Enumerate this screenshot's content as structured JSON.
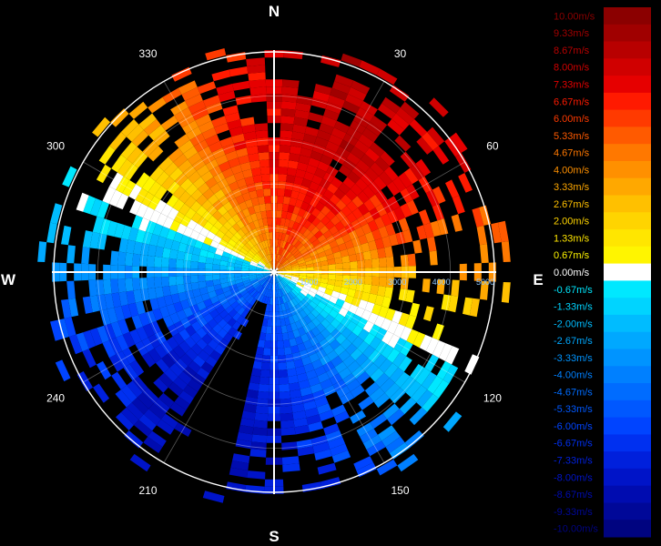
{
  "chart_data": {
    "type": "heatmap",
    "subtype": "polar-ppi",
    "title": "",
    "compass": {
      "north": "N",
      "east": "E",
      "south": "S",
      "west": "W"
    },
    "angle_ticks": [
      {
        "deg": 30,
        "label": "30"
      },
      {
        "deg": 60,
        "label": "60"
      },
      {
        "deg": 120,
        "label": "120"
      },
      {
        "deg": 150,
        "label": "150"
      },
      {
        "deg": 210,
        "label": "210"
      },
      {
        "deg": 240,
        "label": "240"
      },
      {
        "deg": 300,
        "label": "300"
      },
      {
        "deg": 330,
        "label": "330"
      }
    ],
    "range_ticks": [
      {
        "value": 1000,
        "label": "1000"
      },
      {
        "value": 2000,
        "label": "2000"
      },
      {
        "value": 3000,
        "label": "3000"
      },
      {
        "value": 4000,
        "label": "4000"
      },
      {
        "value": 5000,
        "label": "5000"
      }
    ],
    "range_max": 5000,
    "radial_velocity_field": {
      "unit": "m/s",
      "zero_line_azimuth_deg": 115,
      "max_outbound_azimuth_deg": 205,
      "max_inbound_azimuth_deg": 25,
      "peak_speed": 8.5,
      "inner_speed": 5.0,
      "data_gap_azimuths_deg": [
        195,
        200,
        205,
        210
      ]
    },
    "colorbar": {
      "levels": [
        {
          "label": "10.00m/s",
          "value": 10.0,
          "color": "#8b0000"
        },
        {
          "label": "9.33m/s",
          "value": 9.33,
          "color": "#a00000"
        },
        {
          "label": "8.67m/s",
          "value": 8.67,
          "color": "#b80000"
        },
        {
          "label": "8.00m/s",
          "value": 8.0,
          "color": "#d00000"
        },
        {
          "label": "7.33m/s",
          "value": 7.33,
          "color": "#e60000"
        },
        {
          "label": "6.67m/s",
          "value": 6.67,
          "color": "#ff1a00"
        },
        {
          "label": "6.00m/s",
          "value": 6.0,
          "color": "#ff3a00"
        },
        {
          "label": "5.33m/s",
          "value": 5.33,
          "color": "#ff5a00"
        },
        {
          "label": "4.67m/s",
          "value": 4.67,
          "color": "#ff7800"
        },
        {
          "label": "4.00m/s",
          "value": 4.0,
          "color": "#ff9000"
        },
        {
          "label": "3.33m/s",
          "value": 3.33,
          "color": "#ffa800"
        },
        {
          "label": "2.67m/s",
          "value": 2.67,
          "color": "#ffc000"
        },
        {
          "label": "2.00m/s",
          "value": 2.0,
          "color": "#ffd400"
        },
        {
          "label": "1.33m/s",
          "value": 1.33,
          "color": "#ffe600"
        },
        {
          "label": "0.67m/s",
          "value": 0.67,
          "color": "#fff500"
        },
        {
          "label": "0.00m/s",
          "value": 0.0,
          "color": "#ffffff"
        },
        {
          "label": "-0.67m/s",
          "value": -0.67,
          "color": "#00e8ff"
        },
        {
          "label": "-1.33m/s",
          "value": -1.33,
          "color": "#00d4ff"
        },
        {
          "label": "-2.00m/s",
          "value": -2.0,
          "color": "#00bcff"
        },
        {
          "label": "-2.67m/s",
          "value": -2.67,
          "color": "#00a8ff"
        },
        {
          "label": "-3.33m/s",
          "value": -3.33,
          "color": "#0094ff"
        },
        {
          "label": "-4.00m/s",
          "value": -4.0,
          "color": "#0080ff"
        },
        {
          "label": "-4.67m/s",
          "value": -4.67,
          "color": "#006cff"
        },
        {
          "label": "-5.33m/s",
          "value": -5.33,
          "color": "#0058ff"
        },
        {
          "label": "-6.00m/s",
          "value": -6.0,
          "color": "#0044ff"
        },
        {
          "label": "-6.67m/s",
          "value": -6.67,
          "color": "#0030f0"
        },
        {
          "label": "-7.33m/s",
          "value": -7.33,
          "color": "#0020dc"
        },
        {
          "label": "-8.00m/s",
          "value": -8.0,
          "color": "#0014c8"
        },
        {
          "label": "-8.67m/s",
          "value": -8.67,
          "color": "#000cb0"
        },
        {
          "label": "-9.33m/s",
          "value": -9.33,
          "color": "#000898"
        },
        {
          "label": "-10.00m/s",
          "value": -10.0,
          "color": "#000480"
        }
      ]
    },
    "grid": true,
    "legend_placement": "right"
  }
}
